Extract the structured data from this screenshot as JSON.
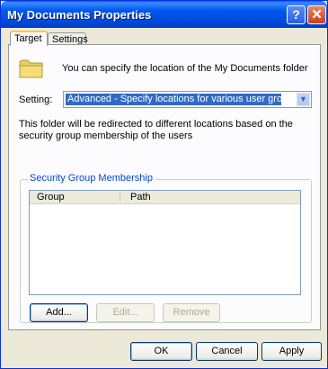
{
  "window": {
    "title": "My Documents Properties",
    "help_label": "?",
    "close_label": "✕"
  },
  "tabs": [
    {
      "label": "Target"
    },
    {
      "label": "Settings"
    }
  ],
  "target": {
    "intro": "You can specify the location of the My Documents folder",
    "setting_label": "Setting:",
    "setting_value": "Advanced - Specify locations for various user groups",
    "description": "This folder will be redirected to different locations based on the security group membership of the users"
  },
  "group_box": {
    "title": "Security Group Membership",
    "columns": [
      "Group",
      "Path"
    ],
    "rows": [],
    "buttons": {
      "add": "Add...",
      "edit": "Edit...",
      "remove": "Remove"
    }
  },
  "footer": {
    "ok": "OK",
    "cancel": "Cancel",
    "apply": "Apply"
  },
  "colors": {
    "titlebar": "#0058ee",
    "selection": "#316ac5",
    "group_title": "#0046d5",
    "face": "#ece9d8"
  }
}
